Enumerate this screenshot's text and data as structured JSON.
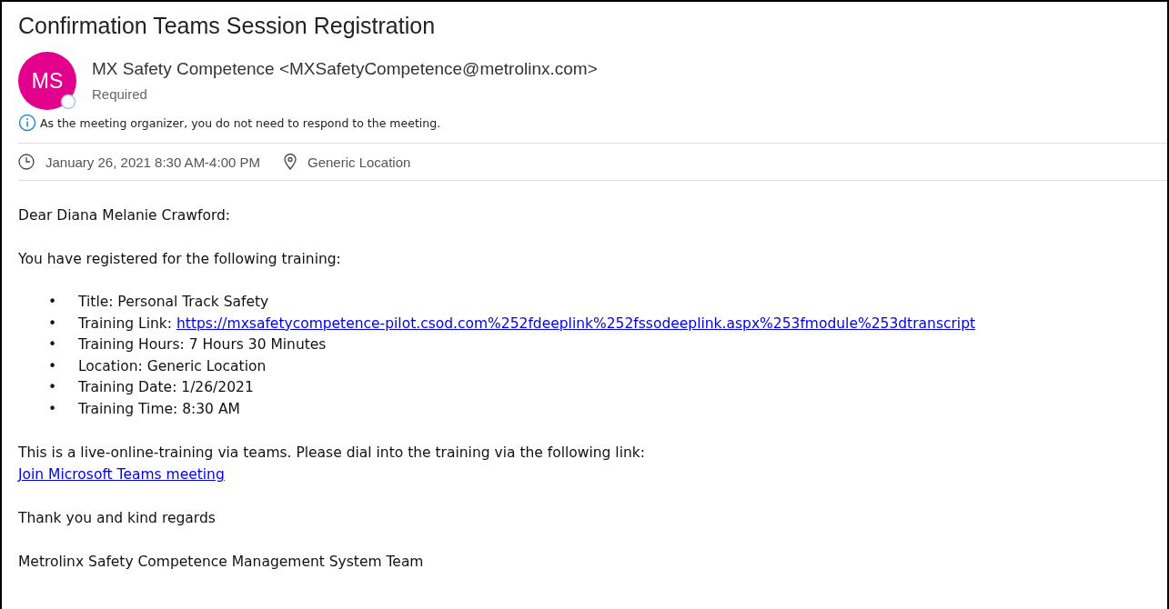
{
  "subject": "Confirmation Teams Session Registration",
  "sender": {
    "initials": "MS",
    "color": "#e3008c",
    "name": "MX Safety Competence <MXSafetyCompetence@metrolinx.com>",
    "role": "Required"
  },
  "info": "As the meeting organizer, you do not need to respond to the meeting.",
  "meeting": {
    "time": "January 26, 2021 8:30 AM-4:00 PM",
    "location": "Generic Location"
  },
  "body": {
    "greeting": "Dear Diana Melanie Crawford:",
    "intro": "You have registered for the following training:",
    "bullet": "•",
    "items": [
      {
        "label": "Title: Personal Track Safety"
      },
      {
        "label": "Training Link: ",
        "link": "https://mxsafetycompetence-pilot.csod.com%252fdeeplink%252fssodeeplink.aspx%253fmodule%253dtranscript"
      },
      {
        "label": "Training Hours: 7 Hours 30 Minutes"
      },
      {
        "label": "Location: Generic Location"
      },
      {
        "label": "Training Date: 1/26/2021"
      },
      {
        "label": "Training Time: 8:30 AM"
      }
    ],
    "note": "This is a live-online-training via teams. Please dial into the training via the following link:",
    "join_link": "Join Microsoft Teams meeting",
    "closing": [
      "Thank you and kind regards",
      "Metrolinx Safety Competence Management System Team"
    ]
  }
}
